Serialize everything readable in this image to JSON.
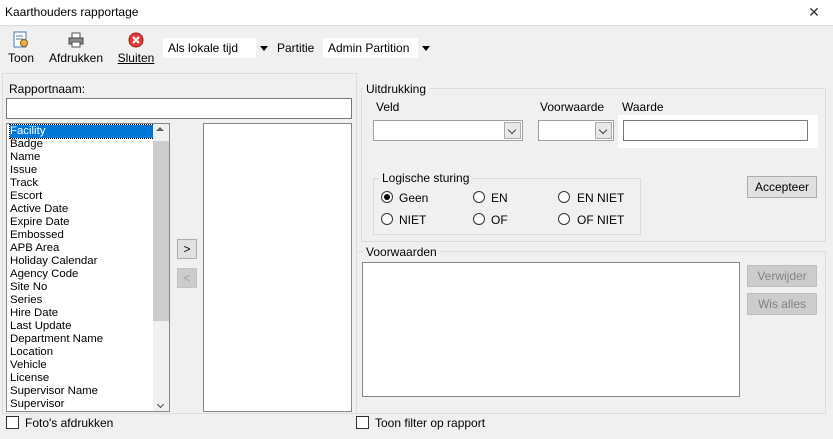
{
  "window": {
    "title": "Kaarthouders rapportage",
    "close": "✕"
  },
  "toolbar": {
    "show_label": "Toon",
    "print_label": "Afdrukken",
    "close_label": "Sluiten",
    "time_combo": "Als lokale tijd",
    "partition_label": "Partitie",
    "partition_combo": "Admin Partition"
  },
  "left": {
    "report_name_label": "Rapportnaam:",
    "report_name_value": "",
    "fields": [
      "Facility",
      "Badge",
      "Name",
      "Issue",
      "Track",
      "Escort",
      "Active Date",
      "Expire Date",
      "Embossed",
      "APB Area",
      "Holiday Calendar",
      "Agency Code",
      "Site No",
      "Series",
      "Hire Date",
      "Last Update",
      "Department Name",
      "Location",
      "Vehicle",
      "License",
      "Supervisor Name",
      "Supervisor"
    ],
    "selected_field": "Facility",
    "add_arrow": ">",
    "remove_arrow": "<",
    "print_photos_label": "Foto's afdrukken"
  },
  "expression": {
    "group_label": "Uitdrukking",
    "field_label": "Veld",
    "condition_label": "Voorwaarde",
    "value_label": "Waarde",
    "value": "",
    "logic": {
      "group_label": "Logische sturing",
      "options": [
        "Geen",
        "EN",
        "EN NIET",
        "NIET",
        "OF",
        "OF NIET"
      ],
      "selected": "Geen"
    },
    "accept_label": "Accepteer"
  },
  "conditions": {
    "group_label": "Voorwaarden",
    "delete_label": "Verwijder",
    "clear_label": "Wis alles"
  },
  "show_filter_label": "Toon filter op rapport"
}
